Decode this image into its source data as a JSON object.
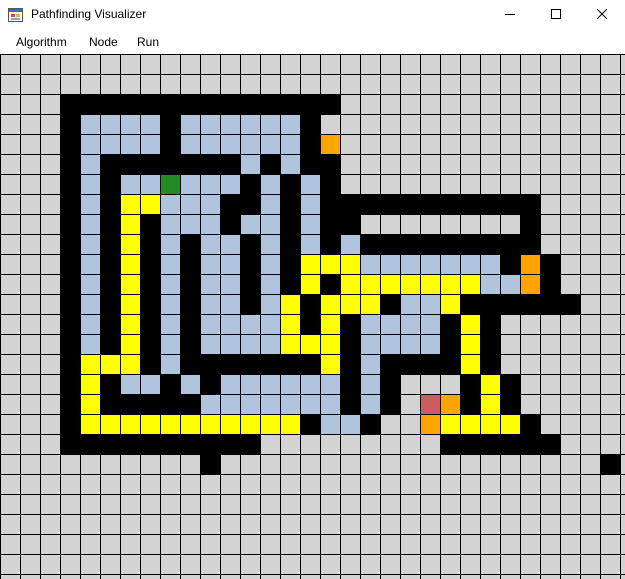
{
  "window": {
    "title": "Pathfinding Visualizer",
    "icon": "app-window-icon",
    "controls": [
      "minimize-icon",
      "maximize-icon",
      "close-icon"
    ]
  },
  "menu": {
    "items": [
      "Algorithm",
      "Node",
      "Run"
    ]
  },
  "grid": {
    "columns": 31,
    "rows": 26,
    "colors": {
      "empty": "#d3d3d3",
      "wall": "#000000",
      "visited": "#b0c4de",
      "path": "#ffff00",
      "frontier": "#ffa500",
      "start": "#228b22",
      "end": "#cd5c5c",
      "line": "#000000"
    },
    "legend": {
      "empty": ".",
      "wall": "#",
      "visited": "v",
      "path": "y",
      "frontier": "o",
      "start": "S",
      "end": "E"
    },
    "cells": [
      "...............................",
      "...............................",
      "...##############..............",
      "...#vvvv#vvvvvv#...............",
      "...#vvvv#vvvvvv#o..............",
      "...#v#######v#v##..............",
      "...#v#vvSvvv#v#v#..............",
      "...#v#yyvvv##v#v###########....",
      "...#v#y#vvv#vv#v##........#....",
      "...#v#y#v#vv#v#v#v#########....",
      "...#v#y#v#vv#v#yyyvvvvvvv#o#...",
      "...#v#y#v#vv#v#y#yyyyyyyvvo#...",
      "...#v#y#v#vv#vy#yyy#vvy######..",
      "...#v#y#v#vvvvy#y#vvvv#y#......",
      "...#v#y#v#vvvvyyy#vvvv#y#......",
      "...#yyy#v#######y#v####y#......",
      "...#y#vv#v#vvvvvv#v#...#y#.....",
      "...#y#####vvvvvvv#v#.Eo#y#.....",
      "...#yyyyyyyyyyy#vv#..oyyyy#....",
      "...##########.........######...",
      "..........#...................#",
      "...............................",
      "...............................",
      "...............................",
      "...............................",
      "..............................."
    ]
  }
}
